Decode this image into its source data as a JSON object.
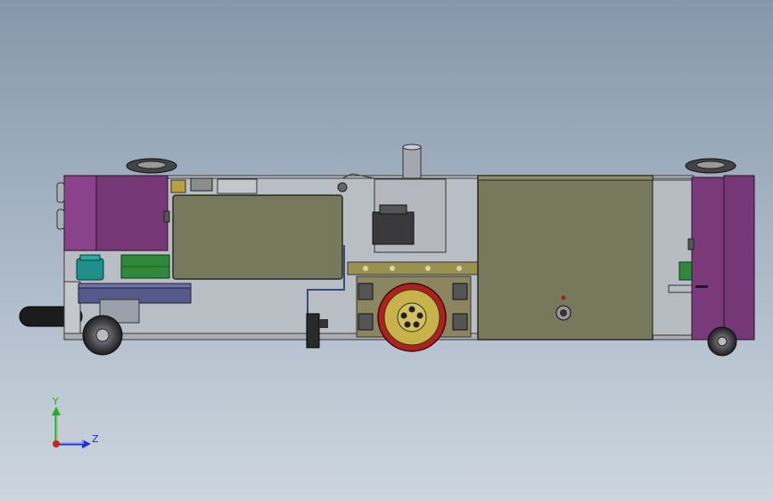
{
  "triad": {
    "y_label": "Y",
    "z_label": "Z",
    "y_color": "#20b020",
    "z_color": "#2030d0",
    "x_color": "#d02020"
  },
  "colors": {
    "frame": "#b8bcc2",
    "olive_panel": "#77795c",
    "purple_housing": "#7a3a7a",
    "drive_wheel": "#c8b24a",
    "wheel_tire": "#b02020",
    "green_board": "#2e8a3a",
    "teal_light": "#1f8f8a"
  },
  "icons": [
    "coordinate-triad-icon"
  ]
}
